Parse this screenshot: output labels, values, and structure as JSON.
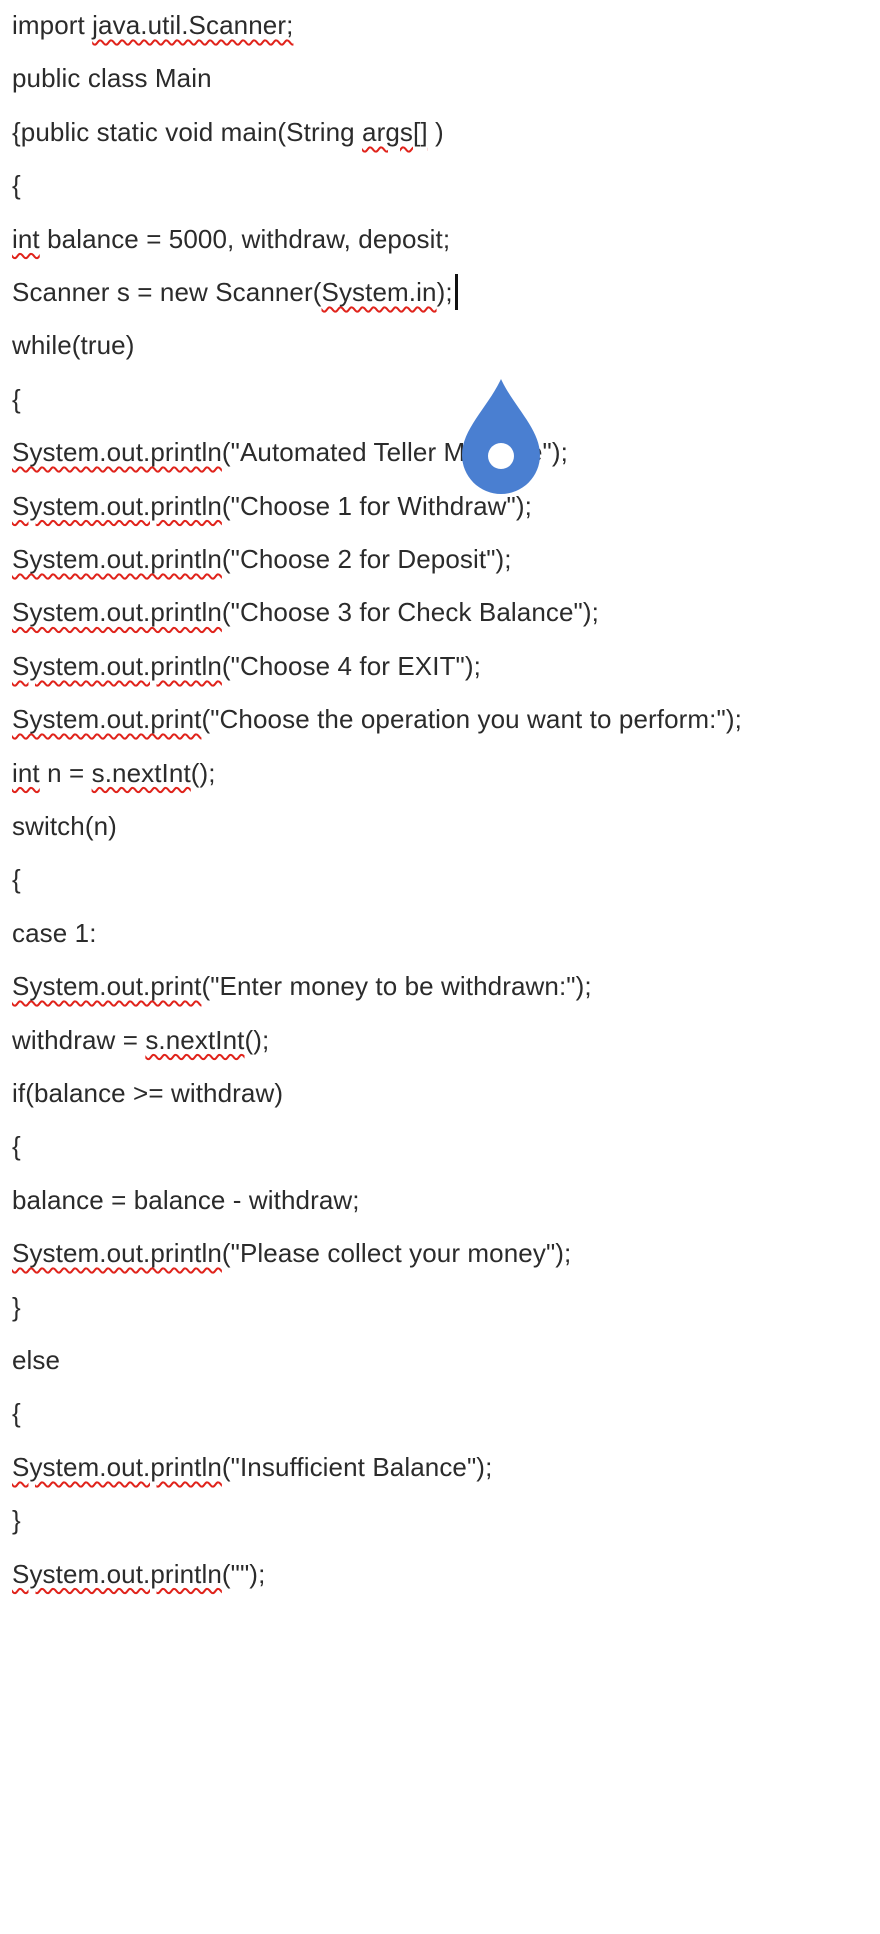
{
  "document": {
    "lines": [
      [
        {
          "t": "import "
        },
        {
          "t": "java.util.Scanner;",
          "spell": true
        }
      ],
      [
        {
          "t": "public class Main"
        }
      ],
      [
        {
          "t": "{public static void main(String "
        },
        {
          "t": "args[]",
          "spell": true
        },
        {
          "t": " )"
        }
      ],
      [
        {
          "t": "{"
        }
      ],
      [
        {
          "t": "int",
          "spell": true
        },
        {
          "t": " balance = 5000, withdraw, deposit;"
        }
      ],
      [
        {
          "t": "Scanner s = new Scanner("
        },
        {
          "t": "System.in",
          "spell": true
        },
        {
          "t": ");"
        }
      ],
      [
        {
          "t": "while(true)"
        }
      ],
      [
        {
          "t": "{"
        }
      ],
      [
        {
          "t": "System.out.println",
          "spell": true
        },
        {
          "t": "(\"Automated Teller Machine\");"
        }
      ],
      [
        {
          "t": "System.out.println",
          "spell": true
        },
        {
          "t": "(\"Choose 1 for Withdraw\");"
        }
      ],
      [
        {
          "t": "System.out.println",
          "spell": true
        },
        {
          "t": "(\"Choose 2 for Deposit\");"
        }
      ],
      [
        {
          "t": "System.out.println",
          "spell": true
        },
        {
          "t": "(\"Choose 3 for Check Balance\");"
        }
      ],
      [
        {
          "t": "System.out.println",
          "spell": true
        },
        {
          "t": "(\"Choose 4 for EXIT\");"
        }
      ],
      [
        {
          "t": "System.out.print",
          "spell": true
        },
        {
          "t": "(\"Choose the operation you want to perform:\");"
        }
      ],
      [
        {
          "t": "int",
          "spell": true
        },
        {
          "t": " n = "
        },
        {
          "t": "s.nextInt",
          "spell": true
        },
        {
          "t": "();"
        }
      ],
      [
        {
          "t": "switch(n)"
        }
      ],
      [
        {
          "t": "{"
        }
      ],
      [
        {
          "t": "case 1:"
        }
      ],
      [
        {
          "t": "System.out.print",
          "spell": true
        },
        {
          "t": "(\"Enter money to be withdrawn:\");"
        }
      ],
      [
        {
          "t": "withdraw = "
        },
        {
          "t": "s.nextInt",
          "spell": true
        },
        {
          "t": "();"
        }
      ],
      [
        {
          "t": "if(balance >= withdraw)"
        }
      ],
      [
        {
          "t": "{"
        }
      ],
      [
        {
          "t": "balance = balance - withdraw;"
        }
      ],
      [
        {
          "t": "System.out.println",
          "spell": true
        },
        {
          "t": "(\"Please collect your money\");"
        }
      ],
      [
        {
          "t": "}"
        }
      ],
      [
        {
          "t": "else"
        }
      ],
      [
        {
          "t": "{"
        }
      ],
      [
        {
          "t": "System.out.println",
          "spell": true
        },
        {
          "t": "(\"Insufficient Balance\");"
        }
      ],
      [
        {
          "t": "}"
        }
      ],
      [
        {
          "t": "System.out.println",
          "spell": true
        },
        {
          "t": "(\"\");"
        }
      ]
    ],
    "caret_line": 5
  },
  "selection_handle": {
    "icon": "text-selection-handle-icon",
    "color": "#4a7fd1"
  },
  "colors": {
    "text": "#2b2b2b",
    "spellcheck_underline": "#e0231b",
    "background": "#ffffff"
  }
}
